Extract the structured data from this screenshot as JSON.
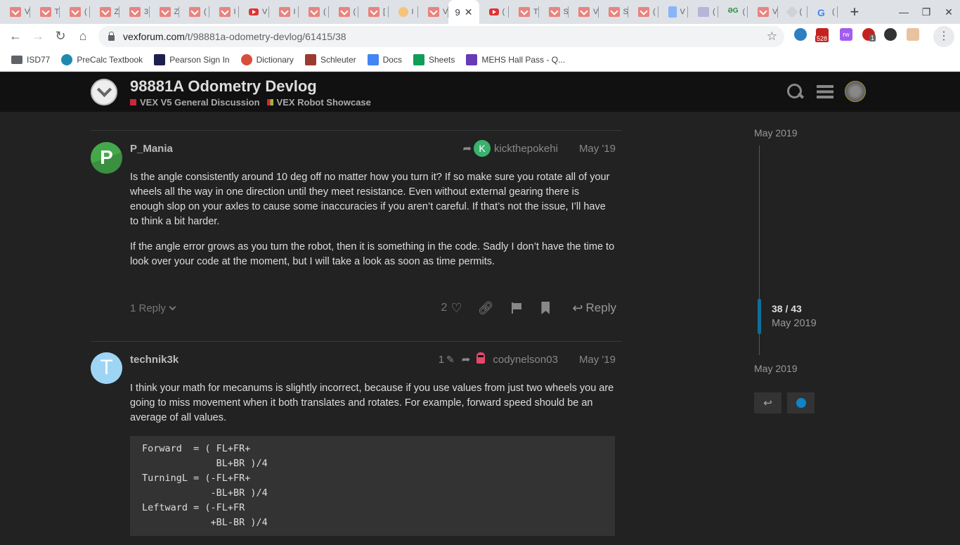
{
  "browser": {
    "tabs": [
      {
        "icon": "vex",
        "title": "V"
      },
      {
        "icon": "vex",
        "title": "T"
      },
      {
        "icon": "vex",
        "title": "("
      },
      {
        "icon": "vex",
        "title": "Z"
      },
      {
        "icon": "vex",
        "title": "3"
      },
      {
        "icon": "vex",
        "title": "Z"
      },
      {
        "icon": "vex",
        "title": "("
      },
      {
        "icon": "vex",
        "title": "I"
      },
      {
        "icon": "yt",
        "title": "V"
      },
      {
        "icon": "vex",
        "title": "I"
      },
      {
        "icon": "vex",
        "title": "("
      },
      {
        "icon": "vex",
        "title": "("
      },
      {
        "icon": "vex",
        "title": "["
      },
      {
        "icon": "coin",
        "title": "I"
      },
      {
        "icon": "vex",
        "title": "V"
      }
    ],
    "active_tab": {
      "title": "9",
      "close": "✕"
    },
    "tabs_after": [
      {
        "icon": "yt",
        "title": "("
      },
      {
        "icon": "vex",
        "title": "T"
      },
      {
        "icon": "vex",
        "title": "S"
      },
      {
        "icon": "vex",
        "title": "V"
      },
      {
        "icon": "vex",
        "title": "S"
      },
      {
        "icon": "vex",
        "title": "("
      },
      {
        "icon": "doc",
        "title": "V"
      },
      {
        "icon": "misc",
        "title": "("
      },
      {
        "icon": "gfg",
        "title": "("
      },
      {
        "icon": "vex",
        "title": "V"
      },
      {
        "icon": "diam",
        "title": "("
      },
      {
        "icon": "gog",
        "title": "("
      }
    ],
    "new_tab": "+",
    "window_controls": {
      "minimize": "—",
      "restore": "❐",
      "close": "✕"
    },
    "nav": {
      "back": "←",
      "forward": "→",
      "reload": "↻",
      "home": "⌂"
    },
    "url_host": "vexforum.com",
    "url_path": "/t/98881a-odometry-devlog/61415/38",
    "star": "☆",
    "extensions": {
      "gmail_badge": "528",
      "adblock_badge": "1",
      "rw_label": "rw"
    },
    "menu": "⋮",
    "bookmarks": [
      {
        "label": "ISD77",
        "icon": "folder",
        "color": "#5f6368"
      },
      {
        "label": "PreCalc Textbook",
        "icon": "pearson-p",
        "color": "#1f8ab0"
      },
      {
        "label": "Pearson Sign In",
        "icon": "pearson",
        "color": "#1d1f4d"
      },
      {
        "label": "Dictionary",
        "icon": "merriam-webster",
        "color": "#d84c3c"
      },
      {
        "label": "Schleuter",
        "icon": "schleuter",
        "color": "#9b3b2e"
      },
      {
        "label": "Docs",
        "icon": "docs",
        "color": "#4285f4"
      },
      {
        "label": "Sheets",
        "icon": "sheets",
        "color": "#0f9d58"
      },
      {
        "label": "MEHS Hall Pass - Q...",
        "icon": "forms",
        "color": "#673ab7"
      }
    ]
  },
  "header": {
    "title": "98881A Odometry Devlog",
    "categories": [
      {
        "name": "VEX V5 General Discussion",
        "color": "#c8283a"
      },
      {
        "name": "VEX Robot Showcase",
        "color": "#a2b33a"
      }
    ]
  },
  "posts": [
    {
      "username": "P_Mania",
      "reply_to_user": "kickthepokehi",
      "reply_to_initial": "K",
      "date": "May '19",
      "paragraphs": [
        "Is the angle consistently around 10 deg off no matter how you turn it? If so make sure you rotate all of your wheels all the way in one direction until they meet resistance. Even without external gearing there is enough slop on your axles to cause some inaccuracies if you aren’t careful. If that’s not the issue, I’ll have to think a bit harder.",
        "If the angle error grows as you turn the robot, then it is something in the code. Sadly I don’t have the time to look over your code at the moment, but I will take a look as soon as time permits."
      ],
      "replies_label": "1 Reply",
      "like_count": "2",
      "reply_label": "Reply"
    },
    {
      "username": "technik3k",
      "edit_count": "1",
      "reply_to_user": "codynelson03",
      "date": "May '19",
      "paragraphs": [
        "I think your math for mecanums is slightly incorrect, because if you use values from just two wheels you are going to miss movement when it both translates and rotates. For example, forward speed should be an average of all values."
      ],
      "code": "Forward  = ( FL+FR+\n             BL+BR )/4\nTurningL = (-FL+FR+\n            -BL+BR )/4\nLeftward = (-FL+FR\n            +BL-BR )/4"
    }
  ],
  "timeline": {
    "start_date": "May 2019",
    "position": "38 / 43",
    "position_date": "May 2019",
    "end_date": "May 2019",
    "progress": 0.88
  },
  "colors": {
    "accent": "#0e6f9a",
    "notification_dot": "#0e85c4"
  }
}
